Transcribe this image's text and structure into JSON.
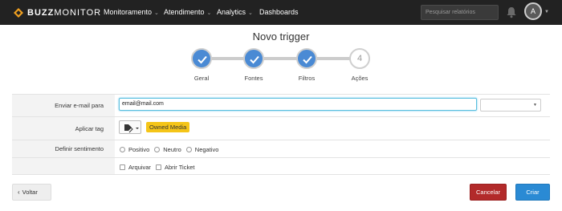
{
  "nav": {
    "logo_bold": "BUZZ",
    "logo_light": "MONITOR",
    "items": [
      {
        "label": "Monitoramento",
        "has_dropdown": true
      },
      {
        "label": "Atendimento",
        "has_dropdown": true
      },
      {
        "label": "Analytics",
        "has_dropdown": true
      },
      {
        "label": "Dashboards",
        "has_dropdown": false
      }
    ],
    "search_placeholder": "Pesquisar relatórios",
    "avatar_initial": "A",
    "icons": [
      "bell-icon",
      "chevron-down-icon"
    ]
  },
  "page": {
    "title": "Novo trigger"
  },
  "steps": [
    {
      "label": "Geral",
      "state": "done"
    },
    {
      "label": "Fontes",
      "state": "done"
    },
    {
      "label": "Filtros",
      "state": "done"
    },
    {
      "label": "Ações",
      "state": "pending",
      "number": "4"
    }
  ],
  "form": {
    "email": {
      "label": "Enviar e-mail para",
      "value": "email@mail.com"
    },
    "tag": {
      "label": "Aplicar tag",
      "badge": "Owned Media"
    },
    "sentiment": {
      "label": "Definir sentimento",
      "options": [
        "Positivo",
        "Neutro",
        "Negativo"
      ]
    },
    "actions": {
      "options": [
        "Arquivar",
        "Abrir Ticket"
      ]
    }
  },
  "footer": {
    "back_label": "Voltar",
    "cancel_label": "Cancelar",
    "create_label": "Criar"
  },
  "colors": {
    "nav_bg": "#222222",
    "step_done": "#4a8ad4",
    "tag_badge": "#f5c518",
    "cancel": "#b22a2a",
    "create": "#2a8ad4"
  }
}
